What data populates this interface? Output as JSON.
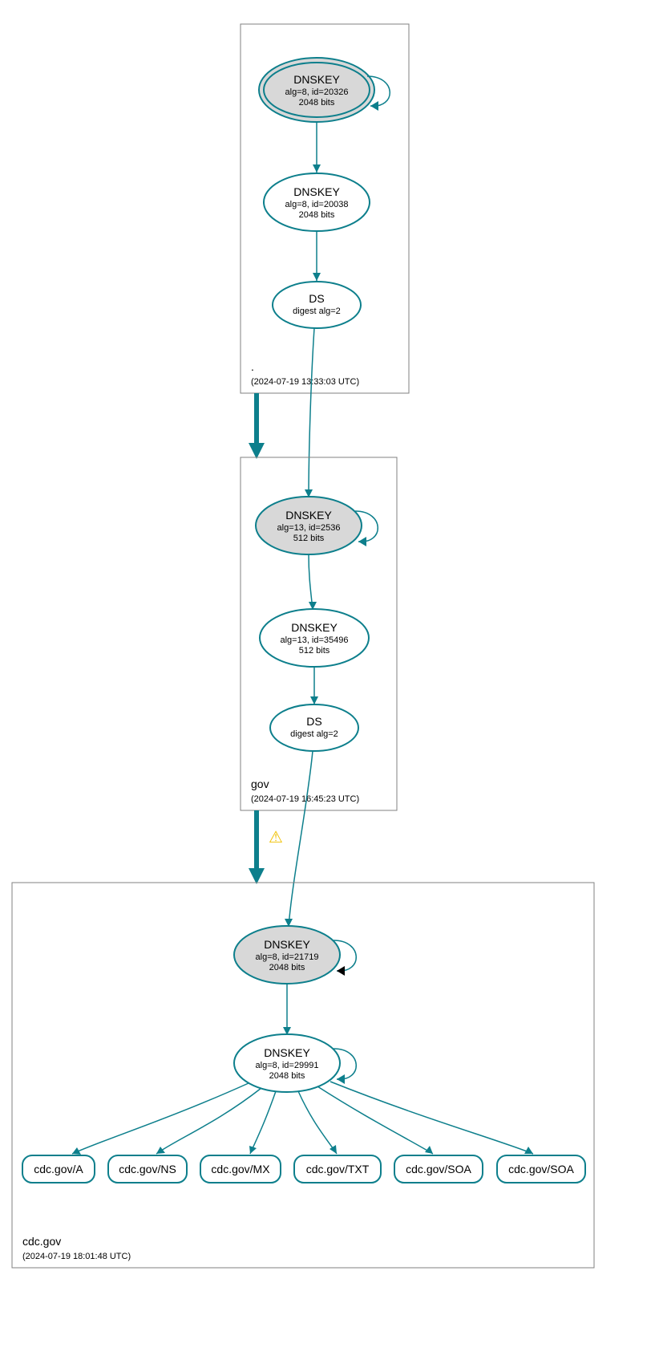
{
  "colors": {
    "teal": "#0d7f8c",
    "grayFill": "#d8d8d8",
    "boxStroke": "#808080"
  },
  "zones": {
    "root": {
      "name": ".",
      "timestamp": "(2024-07-19 13:33:03 UTC)"
    },
    "gov": {
      "name": "gov",
      "timestamp": "(2024-07-19 16:45:23 UTC)"
    },
    "cdc": {
      "name": "cdc.gov",
      "timestamp": "(2024-07-19 18:01:48 UTC)"
    }
  },
  "nodes": {
    "rootKSK": {
      "title": "DNSKEY",
      "line2": "alg=8, id=20326",
      "line3": "2048 bits"
    },
    "rootZSK": {
      "title": "DNSKEY",
      "line2": "alg=8, id=20038",
      "line3": "2048 bits"
    },
    "rootDS": {
      "title": "DS",
      "line2": "digest alg=2"
    },
    "govKSK": {
      "title": "DNSKEY",
      "line2": "alg=13, id=2536",
      "line3": "512 bits"
    },
    "govZSK": {
      "title": "DNSKEY",
      "line2": "alg=13, id=35496",
      "line3": "512 bits"
    },
    "govDS": {
      "title": "DS",
      "line2": "digest alg=2"
    },
    "cdcKSK": {
      "title": "DNSKEY",
      "line2": "alg=8, id=21719",
      "line3": "2048 bits"
    },
    "cdcZSK": {
      "title": "DNSKEY",
      "line2": "alg=8, id=29991",
      "line3": "2048 bits"
    }
  },
  "rrsets": {
    "a": "cdc.gov/A",
    "ns": "cdc.gov/NS",
    "mx": "cdc.gov/MX",
    "txt": "cdc.gov/TXT",
    "soa1": "cdc.gov/SOA",
    "soa2": "cdc.gov/SOA"
  },
  "warning": {
    "glyph": "⚠"
  }
}
